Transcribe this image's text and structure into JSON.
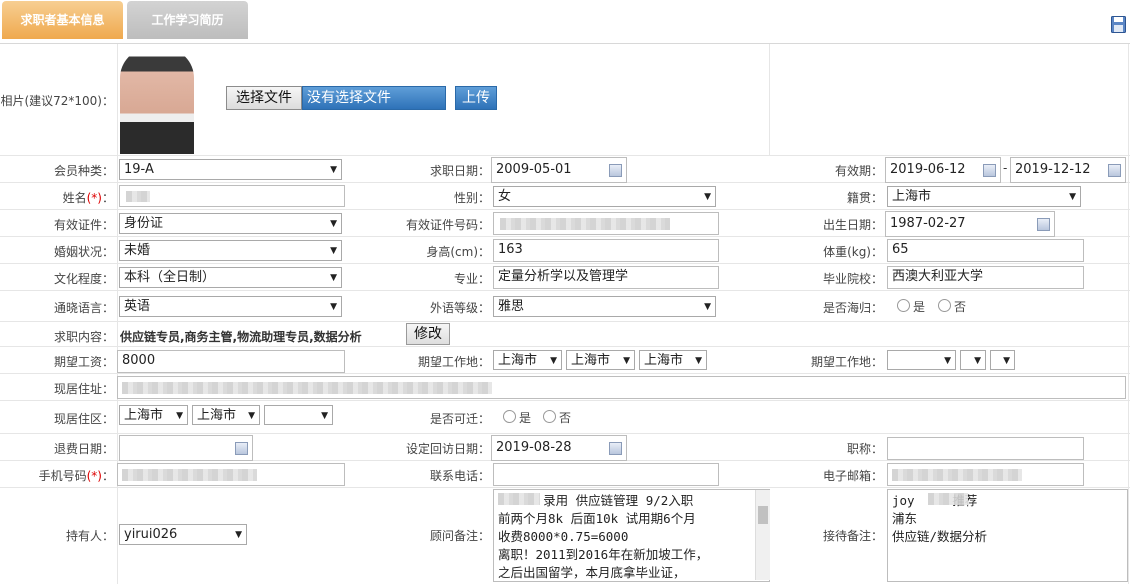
{
  "tabs": {
    "basic": "求职者基本信息",
    "work": "工作学习简历"
  },
  "photo": {
    "label": "相片(建议72*100)：",
    "choose_button": "选择文件",
    "no_file": "没有选择文件",
    "upload_button": "上传"
  },
  "labels": {
    "member_type": "会员种类：",
    "apply_date": "求职日期：",
    "valid_period": "有效期：",
    "name": "姓名",
    "name_suffix": "：",
    "req_mark": "(*)",
    "gender": "性别：",
    "native_place": "籍贯：",
    "id_type": "有效证件：",
    "id_number": "有效证件号码：",
    "birth_date": "出生日期：",
    "marital": "婚姻状况：",
    "height": "身高(cm)：",
    "weight": "体重(kg)：",
    "education": "文化程度：",
    "major": "专业：",
    "school": "毕业院校：",
    "language": "通晓语言：",
    "foreign_level": "外语等级：",
    "returnee": "是否海归：",
    "job_content": "求职内容：",
    "salary": "期望工资：",
    "work_place": "期望工作地：",
    "work_place2": "期望工作地：",
    "address": "现居住址：",
    "area": "现居住区：",
    "relocate": "是否可迁：",
    "refund_date": "退费日期：",
    "revisit_date": "设定回访日期：",
    "title": "职称：",
    "mobile": "手机号码",
    "mobile_suffix": "：",
    "phone": "联系电话：",
    "email": "电子邮箱：",
    "holder": "持有人：",
    "advisor_note": "顾问备注：",
    "reception_note": "接待备注："
  },
  "values": {
    "member_type": "19-A",
    "apply_date": "2009-05-01",
    "valid_from": "2019-06-12",
    "valid_dash": "-",
    "valid_to": "2019-12-12",
    "gender": "女",
    "native_place": "上海市",
    "id_type": "身份证",
    "birth_date": "1987-02-27",
    "marital": "未婚",
    "height": "163",
    "weight": "65",
    "education": "本科（全日制）",
    "major": "定量分析学以及管理学",
    "school": "西澳大利亚大学",
    "language": "英语",
    "foreign_level": "雅思",
    "yes": "是",
    "no": "否",
    "job_content": "供应链专员,商务主管,物流助理专员,数据分析",
    "modify_button": "修改",
    "salary": "8000",
    "wp_province": "上海市",
    "wp_city": "上海市",
    "wp_district": "上海市",
    "area_province": "上海市",
    "area_city": "上海市",
    "revisit_date": "2019-08-28",
    "holder": "yirui026",
    "advisor_note": "      录用 供应链管理 9/2入职\n前两个月8k 后面10k 试用期6个月\n收费8000*0.75=6000\n离职！2011到2016年在新加坡工作，\n之后出国留学，本月底拿毕业证，",
    "reception_note": "joy     推荐\n浦东\n供应链/数据分析"
  },
  "icons": {
    "save": "save-icon",
    "calendar": "calendar-icon",
    "dropdown": "chevron-down-icon"
  },
  "colors": {
    "active_tab": "#f0aa4f",
    "inactive_tab": "#c4c4c4",
    "upload_button": "#2f7fc4"
  }
}
